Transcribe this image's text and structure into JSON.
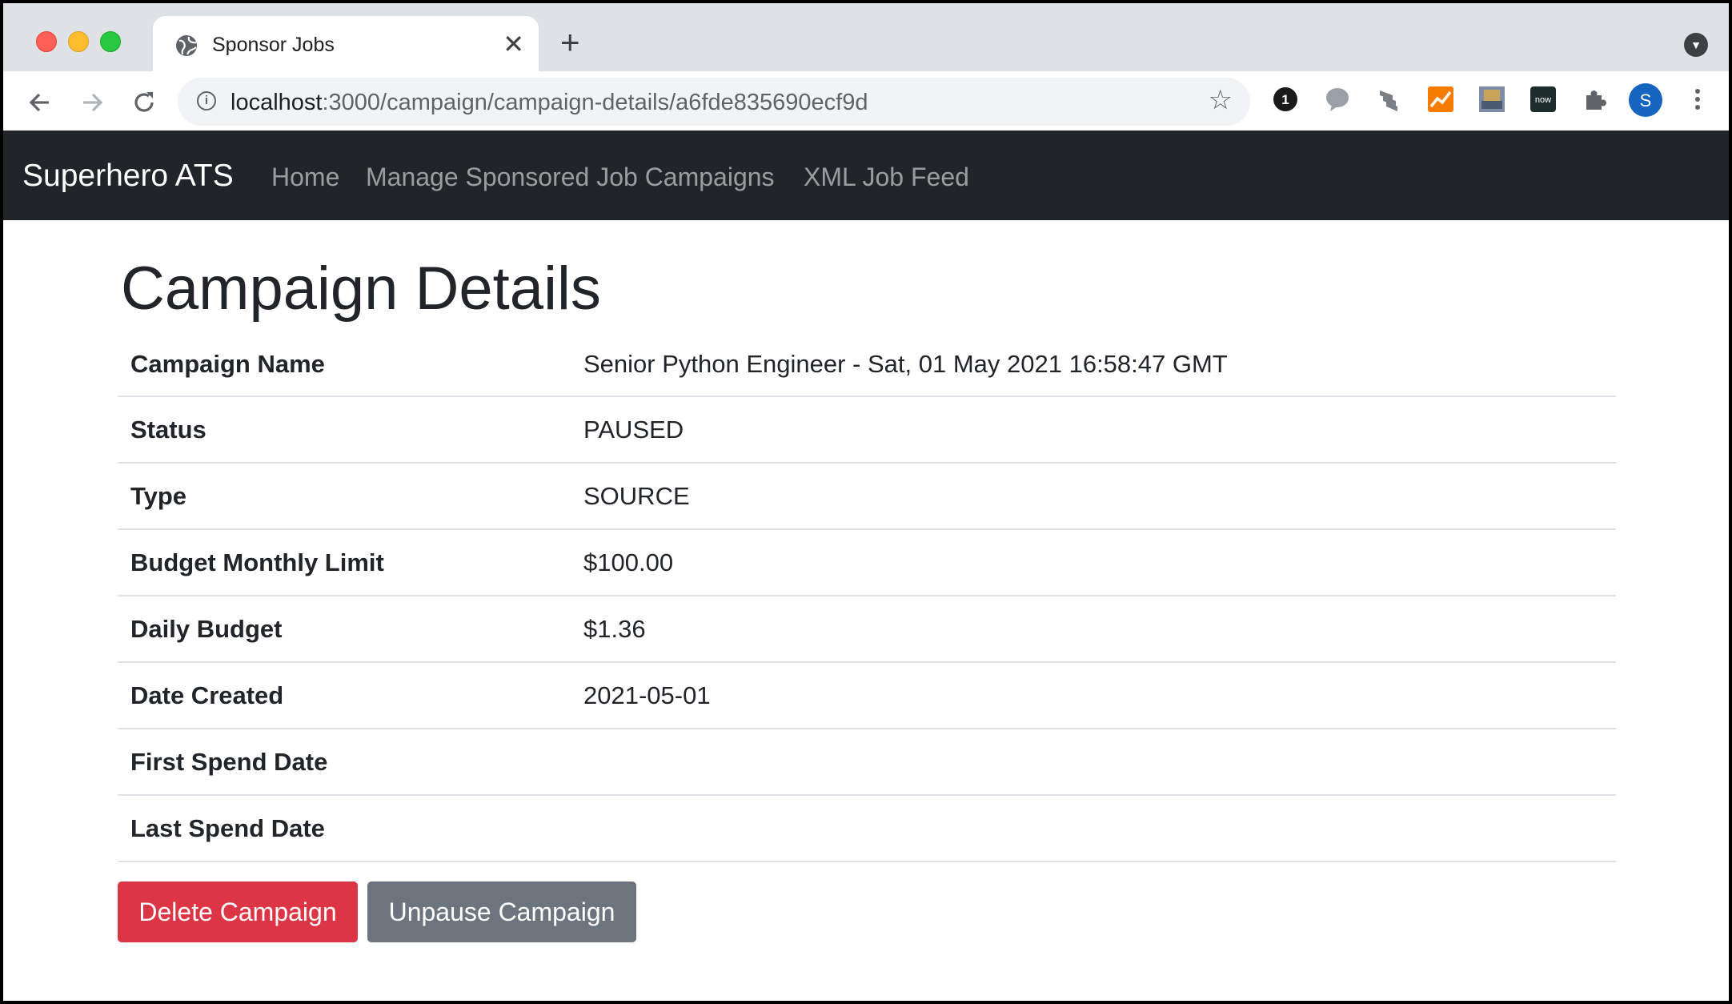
{
  "browser": {
    "tab_title": "Sponsor Jobs",
    "close_glyph": "✕",
    "newtab_glyph": "+",
    "url_host": "localhost",
    "url_rest": ":3000/campaign/campaign-details/a6fde835690ecf9d",
    "profile_initial": "S",
    "extension_badge_1": "1",
    "extension_now": "now",
    "icons": [
      "globe-icon",
      "back-icon",
      "forward-icon",
      "reload-icon",
      "info-icon",
      "star-icon",
      "puzzle-icon",
      "kebab-menu-icon"
    ]
  },
  "navbar": {
    "brand": "Superhero ATS",
    "links": [
      "Home",
      "Manage Sponsored Job Campaigns",
      "XML Job Feed"
    ]
  },
  "page": {
    "title": "Campaign Details",
    "rows": [
      {
        "label": "Campaign Name",
        "value": "Senior Python Engineer - Sat, 01 May 2021 16:58:47 GMT"
      },
      {
        "label": "Status",
        "value": "PAUSED"
      },
      {
        "label": "Type",
        "value": "SOURCE"
      },
      {
        "label": "Budget Monthly Limit",
        "value": "$100.00"
      },
      {
        "label": "Daily Budget",
        "value": "$1.36"
      },
      {
        "label": "Date Created",
        "value": "2021-05-01"
      },
      {
        "label": "First Spend Date",
        "value": ""
      },
      {
        "label": "Last Spend Date",
        "value": ""
      }
    ],
    "buttons": {
      "delete": "Delete Campaign",
      "unpause": "Unpause Campaign"
    }
  },
  "colors": {
    "navbar_bg": "#212529",
    "danger": "#dc3545",
    "secondary": "#6c757d"
  }
}
